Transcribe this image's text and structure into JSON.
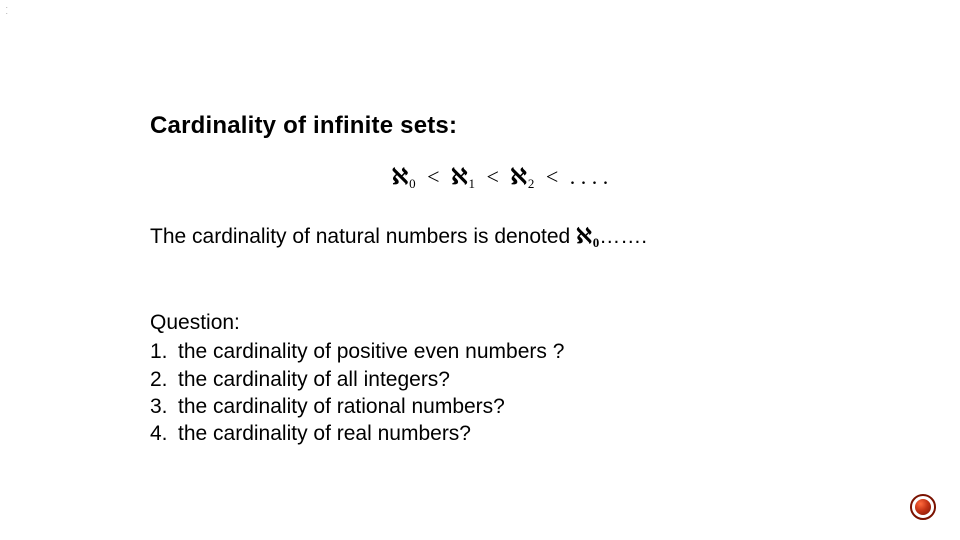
{
  "corner_mark": {
    "line1": ".",
    "line2": "."
  },
  "heading": "Cardinality of infinite sets:",
  "formula": {
    "a0_sym": "ℵ",
    "a0_sub": "0",
    "lt1": "<",
    "a1_sym": "ℵ",
    "a1_sub": "1",
    "lt2": "<",
    "a2_sym": "ℵ",
    "a2_sub": "2",
    "lt3": "<",
    "dots": " . . . ."
  },
  "sentence": {
    "pre": "The cardinality of natural numbers is denoted ",
    "aleph_sym": "ℵ",
    "aleph_sub": "0",
    "post": "……."
  },
  "question": {
    "label": "Question:",
    "items": [
      {
        "num": "1.",
        "text": "the cardinality of positive even numbers ?"
      },
      {
        "num": "2.",
        "text": "the cardinality of all integers?"
      },
      {
        "num": "3.",
        "text": "the cardinality of rational numbers?"
      },
      {
        "num": "4.",
        "text": "the cardinality  of real numbers?"
      }
    ]
  }
}
